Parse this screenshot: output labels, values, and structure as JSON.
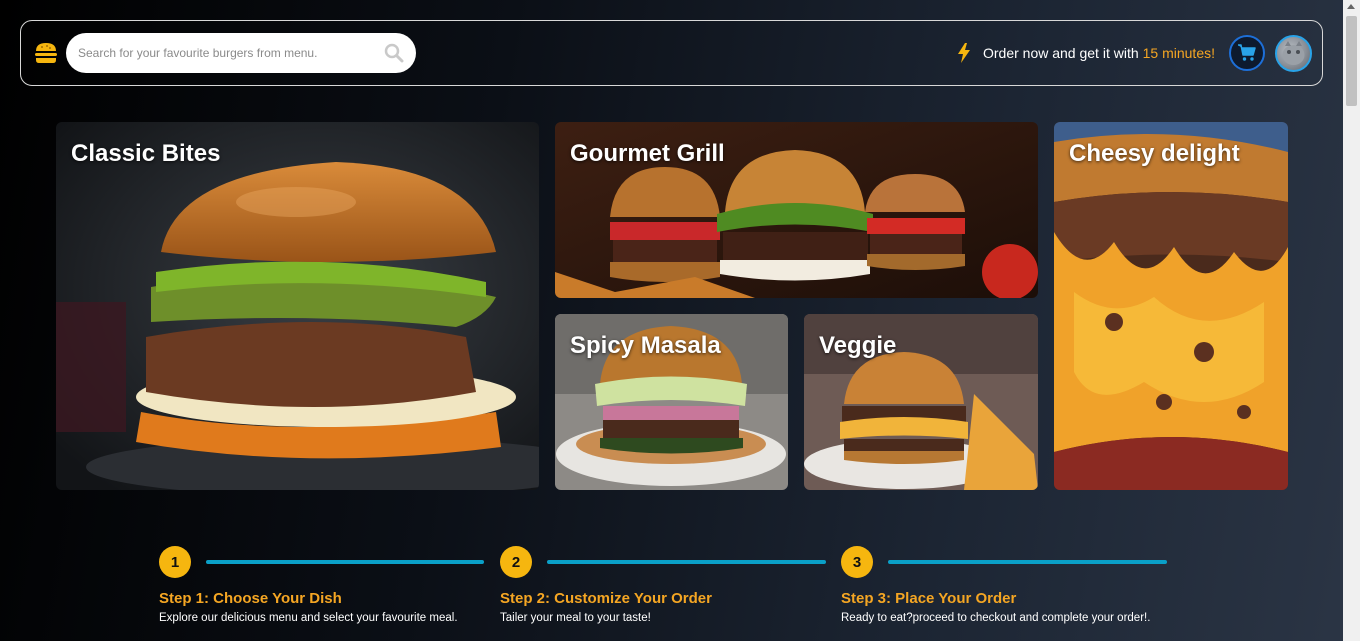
{
  "header": {
    "search_placeholder": "Search for your favourite burgers from menu.",
    "promo_prefix": "Order now and get it with",
    "promo_highlight": "15 minutes!",
    "accent_color": "#f5a623"
  },
  "gallery": {
    "cards": [
      {
        "label": "Classic Bites"
      },
      {
        "label": "Gourmet Grill"
      },
      {
        "label": "Cheesy delight"
      },
      {
        "label": "Spicy Masala"
      },
      {
        "label": "Veggie"
      }
    ]
  },
  "steps": [
    {
      "number": "1",
      "title": "Step 1: Choose Your Dish",
      "description": "Explore our delicious menu and select your favourite meal."
    },
    {
      "number": "2",
      "title": "Step 2: Customize Your Order",
      "description": "Tailer your meal to your taste!"
    },
    {
      "number": "3",
      "title": "Step 3: Place Your Order",
      "description": "Ready to eat?proceed to checkout and complete your order!."
    }
  ],
  "icons": {
    "logo": "burger-icon",
    "search": "search-icon",
    "promo": "bolt-icon",
    "cart": "cart-icon",
    "avatar": "user-avatar"
  },
  "colors": {
    "step_circle": "#f6b60f",
    "step_line": "#0aa0c8",
    "step_title": "#f5a623",
    "cart_border": "#1d6fd8"
  }
}
